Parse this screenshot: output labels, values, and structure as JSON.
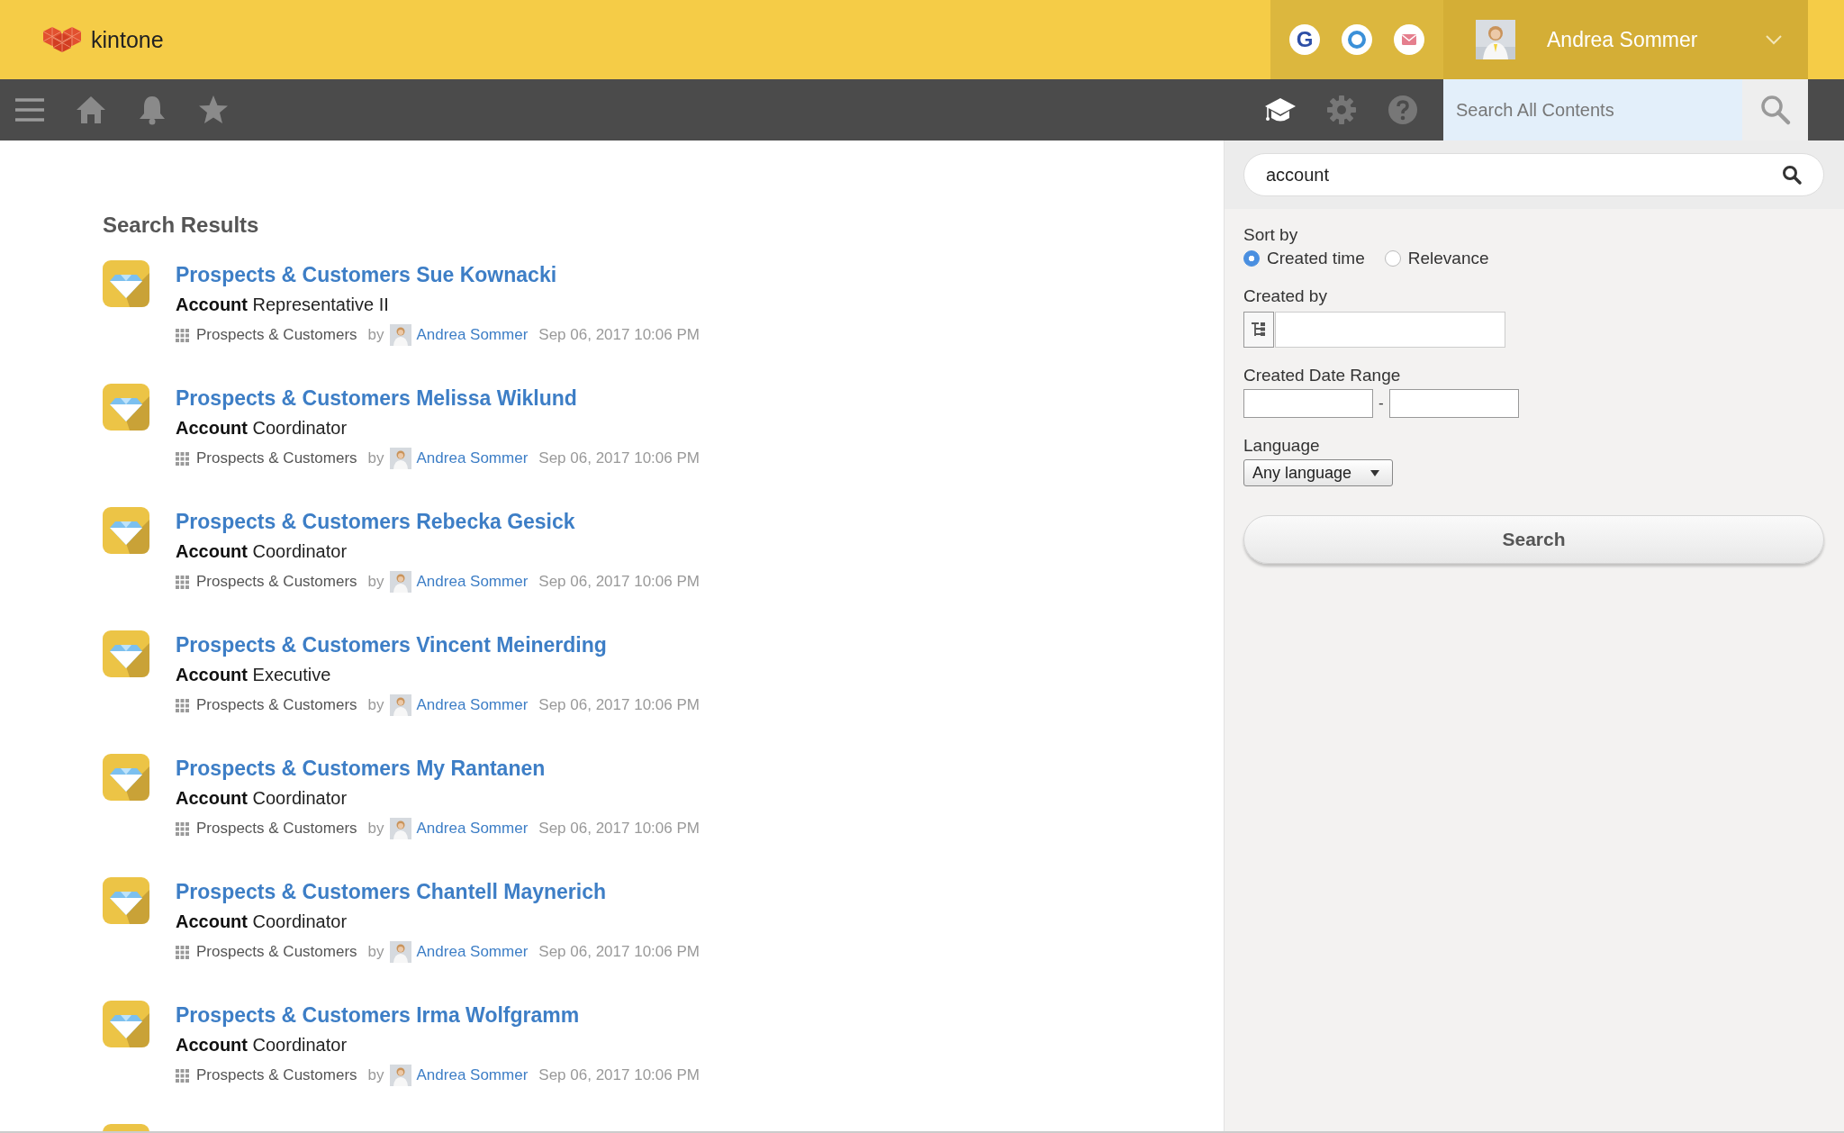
{
  "app": {
    "name": "kintone"
  },
  "header": {
    "shortcuts": [
      {
        "kind": "letter",
        "text": "G"
      },
      {
        "kind": "ring"
      },
      {
        "kind": "mail"
      }
    ],
    "user_name": "Andrea Sommer",
    "search_placeholder": "Search All Contents"
  },
  "results": {
    "title": "Search Results",
    "items": [
      {
        "title": "Prospects & Customers Sue Kownacki",
        "summary": "**Account** Representative II",
        "app": "Prospects & Customers",
        "by": "by",
        "author": "Andrea Sommer",
        "date": "Sep 06, 2017 10:06 PM"
      },
      {
        "title": "Prospects & Customers Melissa Wiklund",
        "summary": "**Account** Coordinator",
        "app": "Prospects & Customers",
        "by": "by",
        "author": "Andrea Sommer",
        "date": "Sep 06, 2017 10:06 PM"
      },
      {
        "title": "Prospects & Customers Rebecka Gesick",
        "summary": "**Account** Coordinator",
        "app": "Prospects & Customers",
        "by": "by",
        "author": "Andrea Sommer",
        "date": "Sep 06, 2017 10:06 PM"
      },
      {
        "title": "Prospects & Customers Vincent Meinerding",
        "summary": "**Account** Executive",
        "app": "Prospects & Customers",
        "by": "by",
        "author": "Andrea Sommer",
        "date": "Sep 06, 2017 10:06 PM"
      },
      {
        "title": "Prospects & Customers My Rantanen",
        "summary": "**Account** Coordinator",
        "app": "Prospects & Customers",
        "by": "by",
        "author": "Andrea Sommer",
        "date": "Sep 06, 2017 10:06 PM"
      },
      {
        "title": "Prospects & Customers Chantell Maynerich",
        "summary": "**Account** Coordinator",
        "app": "Prospects & Customers",
        "by": "by",
        "author": "Andrea Sommer",
        "date": "Sep 06, 2017 10:06 PM"
      },
      {
        "title": "Prospects & Customers Irma Wolfgramm",
        "summary": "**Account** Coordinator",
        "app": "Prospects & Customers",
        "by": "by",
        "author": "Andrea Sommer",
        "date": "Sep 06, 2017 10:06 PM"
      }
    ]
  },
  "filters": {
    "query": "account",
    "sort_label": "Sort by",
    "sort_options": [
      {
        "label": "Created time",
        "selected": true
      },
      {
        "label": "Relevance",
        "selected": false
      }
    ],
    "created_by_label": "Created by",
    "date_range_label": "Created Date Range",
    "date_separator": "-",
    "language_label": "Language",
    "language_value": "Any language",
    "search_button": "Search"
  }
}
